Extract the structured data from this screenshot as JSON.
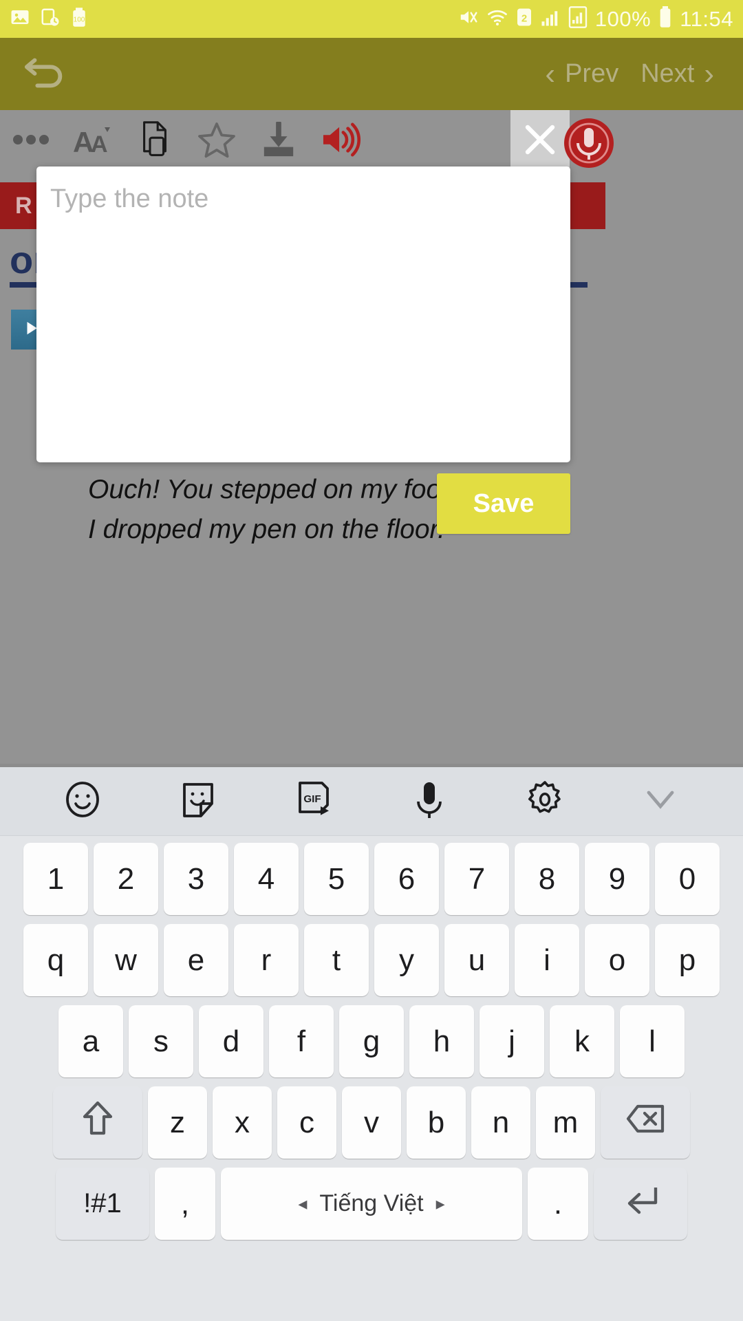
{
  "status_bar": {
    "background": "#e0de46",
    "left_icons": [
      "photo-icon",
      "clock-device-icon",
      "battery-saver-100-icon"
    ],
    "right_icons": [
      "mute-vibrate-icon",
      "wifi-icon",
      "sim2-icon",
      "signal-bars-icon",
      "signal-device-icon"
    ],
    "battery_text": "100%",
    "battery_icon": "battery-full-icon",
    "time": "11:54"
  },
  "nav_bar": {
    "background": "#847e1e",
    "back_icon": "undo-arrow-icon",
    "prev_label": "Prev",
    "next_label": "Next",
    "prev_icon": "chevron-left-icon",
    "next_icon": "chevron-right-icon",
    "text_color": "#b5b083"
  },
  "toolbar": {
    "background": "#939393",
    "items": [
      {
        "name": "more-options-icon",
        "label": "•••"
      },
      {
        "name": "font-size-icon",
        "label": "AĂ"
      },
      {
        "name": "copy-document-icon",
        "label": "copy"
      },
      {
        "name": "favorite-star-icon",
        "label": "star"
      },
      {
        "name": "download-icon",
        "label": "download"
      },
      {
        "name": "speaker-volume-icon",
        "label": "speaker"
      }
    ],
    "close_label": "×",
    "close_background": "#cfcfcf",
    "mic_icon": "record-mic-icon",
    "mic_color": "#b32020"
  },
  "content": {
    "red_bar_text": "R",
    "red_bar_color": "#991b1b",
    "headword": "on",
    "headword_color": "#22315c",
    "play_icon": "play-audio-icon",
    "sentences": [
      "Ouch! You stepped on my foot.",
      "I dropped my pen on the floor."
    ],
    "save_label": "Save",
    "save_color": "#e2dd42"
  },
  "note_dialog": {
    "placeholder": "Type the note",
    "value": "",
    "background": "#ffffff"
  },
  "keyboard": {
    "background": "#e3e5e8",
    "toolbar_icons": [
      "emoji-smiley-icon",
      "sticker-icon",
      "gif-icon",
      "microphone-icon",
      "settings-gear-icon",
      "chevron-down-icon"
    ],
    "gif_label": "GIF",
    "rows": {
      "numbers": [
        "1",
        "2",
        "3",
        "4",
        "5",
        "6",
        "7",
        "8",
        "9",
        "0"
      ],
      "line1": [
        "q",
        "w",
        "e",
        "r",
        "t",
        "y",
        "u",
        "i",
        "o",
        "p"
      ],
      "line2": [
        "a",
        "s",
        "d",
        "f",
        "g",
        "h",
        "j",
        "k",
        "l"
      ],
      "line3": [
        "z",
        "x",
        "c",
        "v",
        "b",
        "n",
        "m"
      ]
    },
    "shift_icon": "shift-arrow-up-icon",
    "backspace_icon": "backspace-delete-icon",
    "symbols_label": "!#1",
    "comma_label": ",",
    "space_label": "Tiếng Việt",
    "space_left_arrow": "◂",
    "space_right_arrow": "▸",
    "period_label": ".",
    "enter_icon": "enter-return-icon"
  }
}
